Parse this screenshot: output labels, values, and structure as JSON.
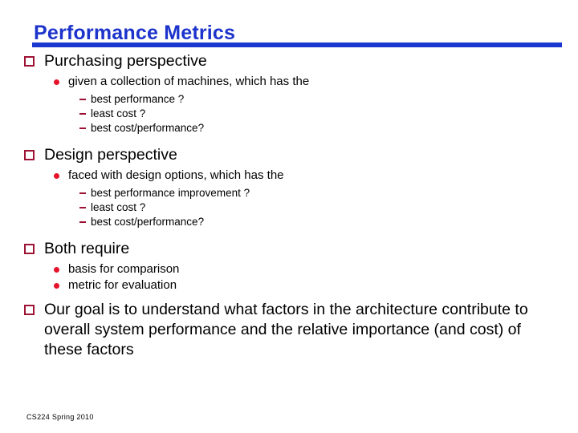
{
  "slide": {
    "title": "Performance Metrics",
    "footer": "CS224 Spring 2010",
    "colors": {
      "title_blue": "#1c33cc",
      "rule_blue": "#1a37cf",
      "square_bullet": "#9e1334",
      "dot_bullet": "#e8122b",
      "text": "#000000",
      "background": "#ffffff"
    },
    "bullets": {
      "square": "square-bullet-icon",
      "disc": "disc-bullet-icon",
      "dash": "dash-bullet-icon"
    },
    "sections": [
      {
        "heading": "Purchasing perspective",
        "sub": [
          {
            "text": "given a collection of machines, which has the",
            "items": [
              "best performance ?",
              "least cost ?",
              "best cost/performance?"
            ]
          }
        ]
      },
      {
        "heading": "Design perspective",
        "sub": [
          {
            "text": "faced with design options, which has the",
            "items": [
              "best performance improvement ?",
              "least cost ?",
              "best cost/performance?"
            ]
          }
        ]
      },
      {
        "heading": "Both require",
        "sub": [
          {
            "text": "basis for comparison",
            "items": []
          },
          {
            "text": "metric for evaluation",
            "items": []
          }
        ]
      },
      {
        "heading": "Our goal is to understand what factors in the architecture contribute to overall system performance and the relative importance (and cost) of these factors",
        "sub": []
      }
    ]
  }
}
